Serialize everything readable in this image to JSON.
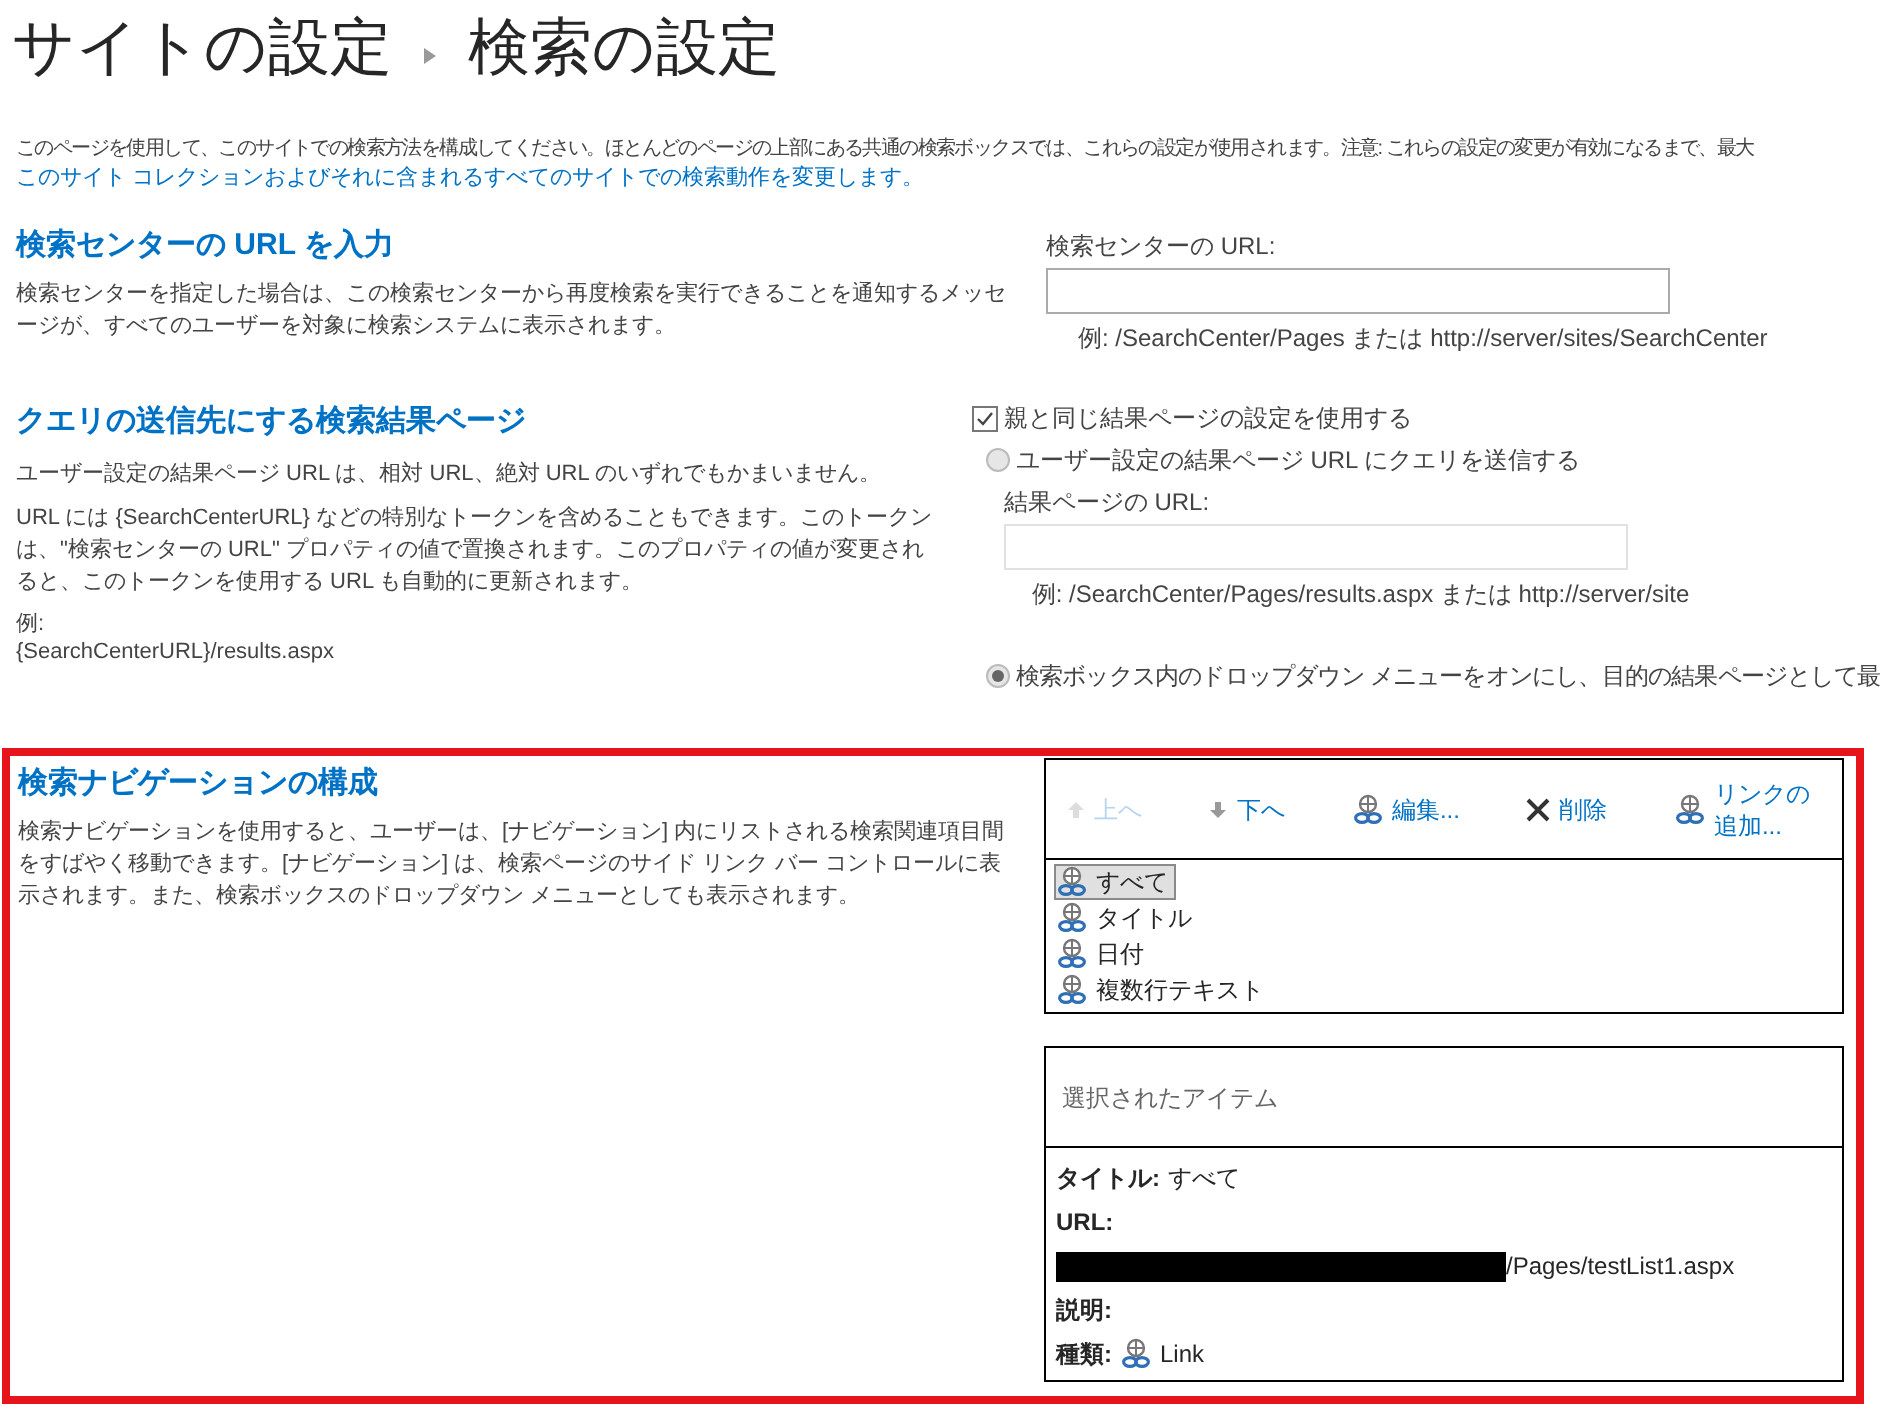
{
  "title": {
    "site": "サイトの設定",
    "page": "検索の設定"
  },
  "intro": {
    "text": "このページを使用して、このサイトでの検索方法を構成してください。ほとんどのページの上部にある共通の検索ボックスでは、これらの設定が使用されます。注意: これらの設定の変更が有効になるまで、最大",
    "link": "このサイト コレクションおよびそれに含まれるすべてのサイトでの検索動作を変更します。"
  },
  "search_center": {
    "heading": "検索センターの URL を入力",
    "description": "検索センターを指定した場合は、この検索センターから再度検索を実行できることを通知するメッセージが、すべてのユーザーを対象に検索システムに表示されます。",
    "field_label": "検索センターの URL:",
    "example": "例: /SearchCenter/Pages または http://server/sites/SearchCenter"
  },
  "results_page": {
    "heading": "クエリの送信先にする検索結果ページ",
    "descriptions": [
      "ユーザー設定の結果ページ URL は、相対 URL、絶対 URL のいずれでもかまいません。",
      "URL には {SearchCenterURL} などの特別なトークンを含めることもできます。このトークンは、\"検索センターの URL\" プロパティの値で置換されます。このプロパティの値が変更されると、このトークンを使用する URL も自動的に更新されます。"
    ],
    "example_label": "例:",
    "example_value": "{SearchCenterURL}/results.aspx",
    "checkbox": {
      "label": "親と同じ結果ページの設定を使用する",
      "checked": true
    },
    "custom_option": {
      "label": "ユーザー設定の結果ページ URL にクエリを送信する",
      "selected": false
    },
    "url_label": "結果ページの URL:",
    "url_example": "例: /SearchCenter/Pages/results.aspx または http://server/site",
    "dropdown_option": {
      "label": "検索ボックス内のドロップダウン メニューをオンにし、目的の結果ページとして最",
      "selected": true
    }
  },
  "navigation": {
    "heading": "検索ナビゲーションの構成",
    "description": "検索ナビゲーションを使用すると、ユーザーは、[ナビゲーション] 内にリストされる検索関連項目間をすばやく移動できます。[ナビゲーション] は、検索ページのサイド リンク バー コントロールに表示されます。また、検索ボックスのドロップダウン メニューとしても表示されます。",
    "toolbar": [
      {
        "kind": "up",
        "label": "上へ",
        "disabled": true
      },
      {
        "kind": "down",
        "label": "下へ",
        "disabled": false
      },
      {
        "kind": "edit",
        "label": "編集...",
        "disabled": false
      },
      {
        "kind": "delete",
        "label": "削除",
        "disabled": false
      },
      {
        "kind": "add",
        "label": "リンクの追加...",
        "disabled": false
      }
    ],
    "links": [
      {
        "label": "すべて",
        "selected": true
      },
      {
        "label": "タイトル",
        "selected": false
      },
      {
        "label": "日付",
        "selected": false
      },
      {
        "label": "複数行テキスト",
        "selected": false
      }
    ],
    "details": {
      "header": "選択されたアイテム",
      "title_label": "タイトル:",
      "title_value": "すべて",
      "url_label": "URL:",
      "url_value": "/Pages/testList1.aspx",
      "description_label": "説明:",
      "type_label": "種類:",
      "type_value": "Link"
    }
  }
}
